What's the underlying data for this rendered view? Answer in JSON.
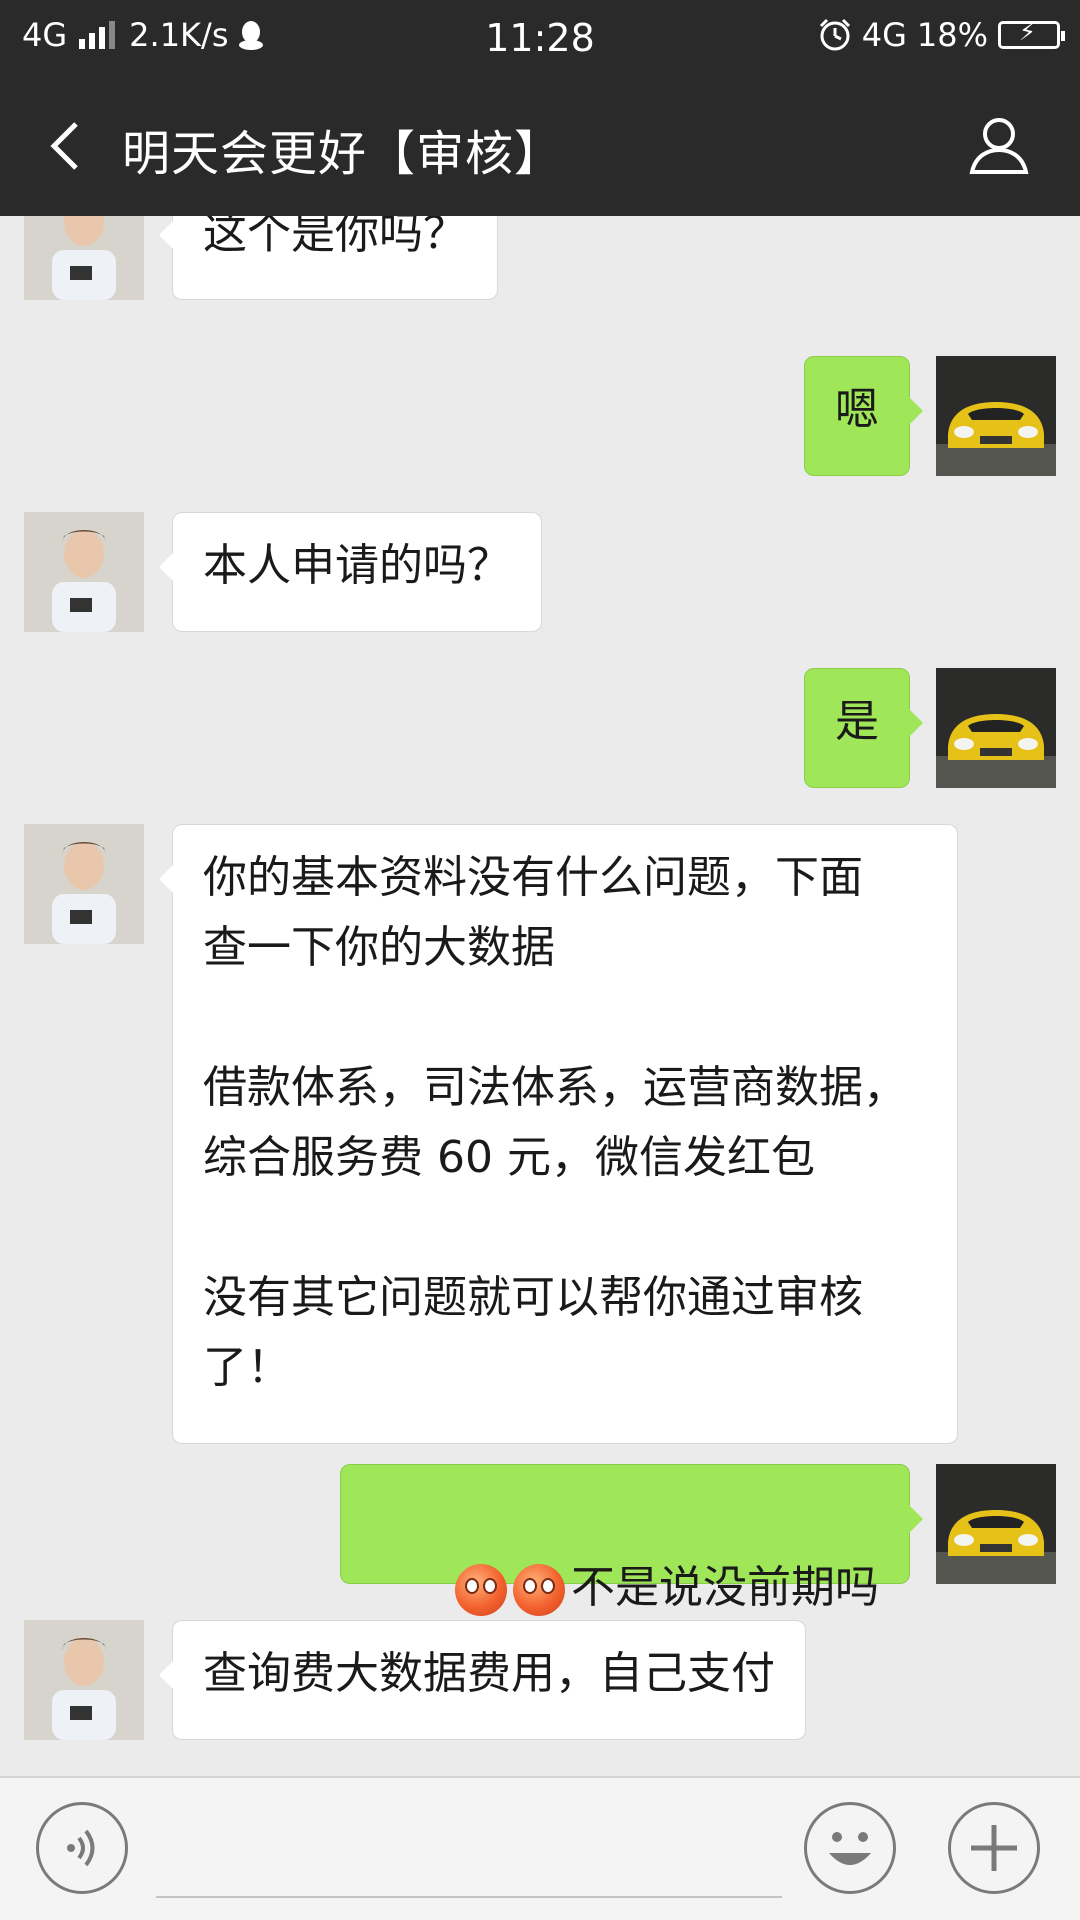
{
  "status_bar": {
    "network_left": "4G",
    "speed": "2.1K/s",
    "time": "11:28",
    "network_right": "4G",
    "battery": "18%"
  },
  "header": {
    "title": "明天会更好【审核】"
  },
  "messages": [
    {
      "side": "in",
      "text": "这个是你吗？"
    },
    {
      "side": "out",
      "text": "嗯"
    },
    {
      "side": "in",
      "text": "本人申请的吗？"
    },
    {
      "side": "out",
      "text": "是"
    },
    {
      "side": "in",
      "text": "你的基本资料没有什么问题，下面\n查一下你的大数据\n\n借款体系，司法体系，运营商数据，\n综合服务费 60 元，微信发红包\n\n没有其它问题就可以帮你通过审核\n了！"
    },
    {
      "side": "out",
      "text": "不是说没前期吗",
      "emoji_count": 2
    },
    {
      "side": "in",
      "text": "查询费大数据费用，自己支付"
    }
  ],
  "input_bar": {
    "value": "",
    "placeholder": ""
  },
  "colors": {
    "header_bg": "#2a2a2a",
    "chat_bg": "#ebebeb",
    "out_bubble": "#9fe658",
    "in_bubble": "#ffffff"
  }
}
